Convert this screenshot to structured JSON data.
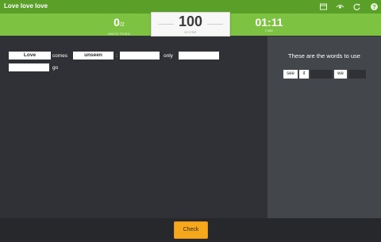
{
  "app": {
    "title": "Love love love"
  },
  "toolbar": {
    "icons": [
      "window-icon",
      "eye-icon",
      "refresh-icon",
      "help-icon"
    ]
  },
  "stats": {
    "hints": {
      "value": "0",
      "max": "/2",
      "label": "HINTS TRIED"
    },
    "score": {
      "value": "100",
      "label": "SCORE"
    },
    "time": {
      "value": "01:11",
      "label": "TIME"
    }
  },
  "exercise": {
    "tokens": {
      "t1": "Love",
      "t2": "comes",
      "t3": "unseen",
      "t4": ":",
      "t5": "",
      "t6": "only",
      "t7": "",
      "t8": "",
      "t9": "go"
    }
  },
  "word_bank": {
    "title": "These are the words to use",
    "words": [
      "see",
      "it",
      "",
      "we",
      ""
    ]
  },
  "footer": {
    "check_label": "Check"
  },
  "colors": {
    "topbar": "#5a9f28",
    "statsbar": "#7dc241",
    "main_bg": "#2f3136",
    "panel_bg": "#43464b",
    "check_button": "#f5a81c"
  }
}
